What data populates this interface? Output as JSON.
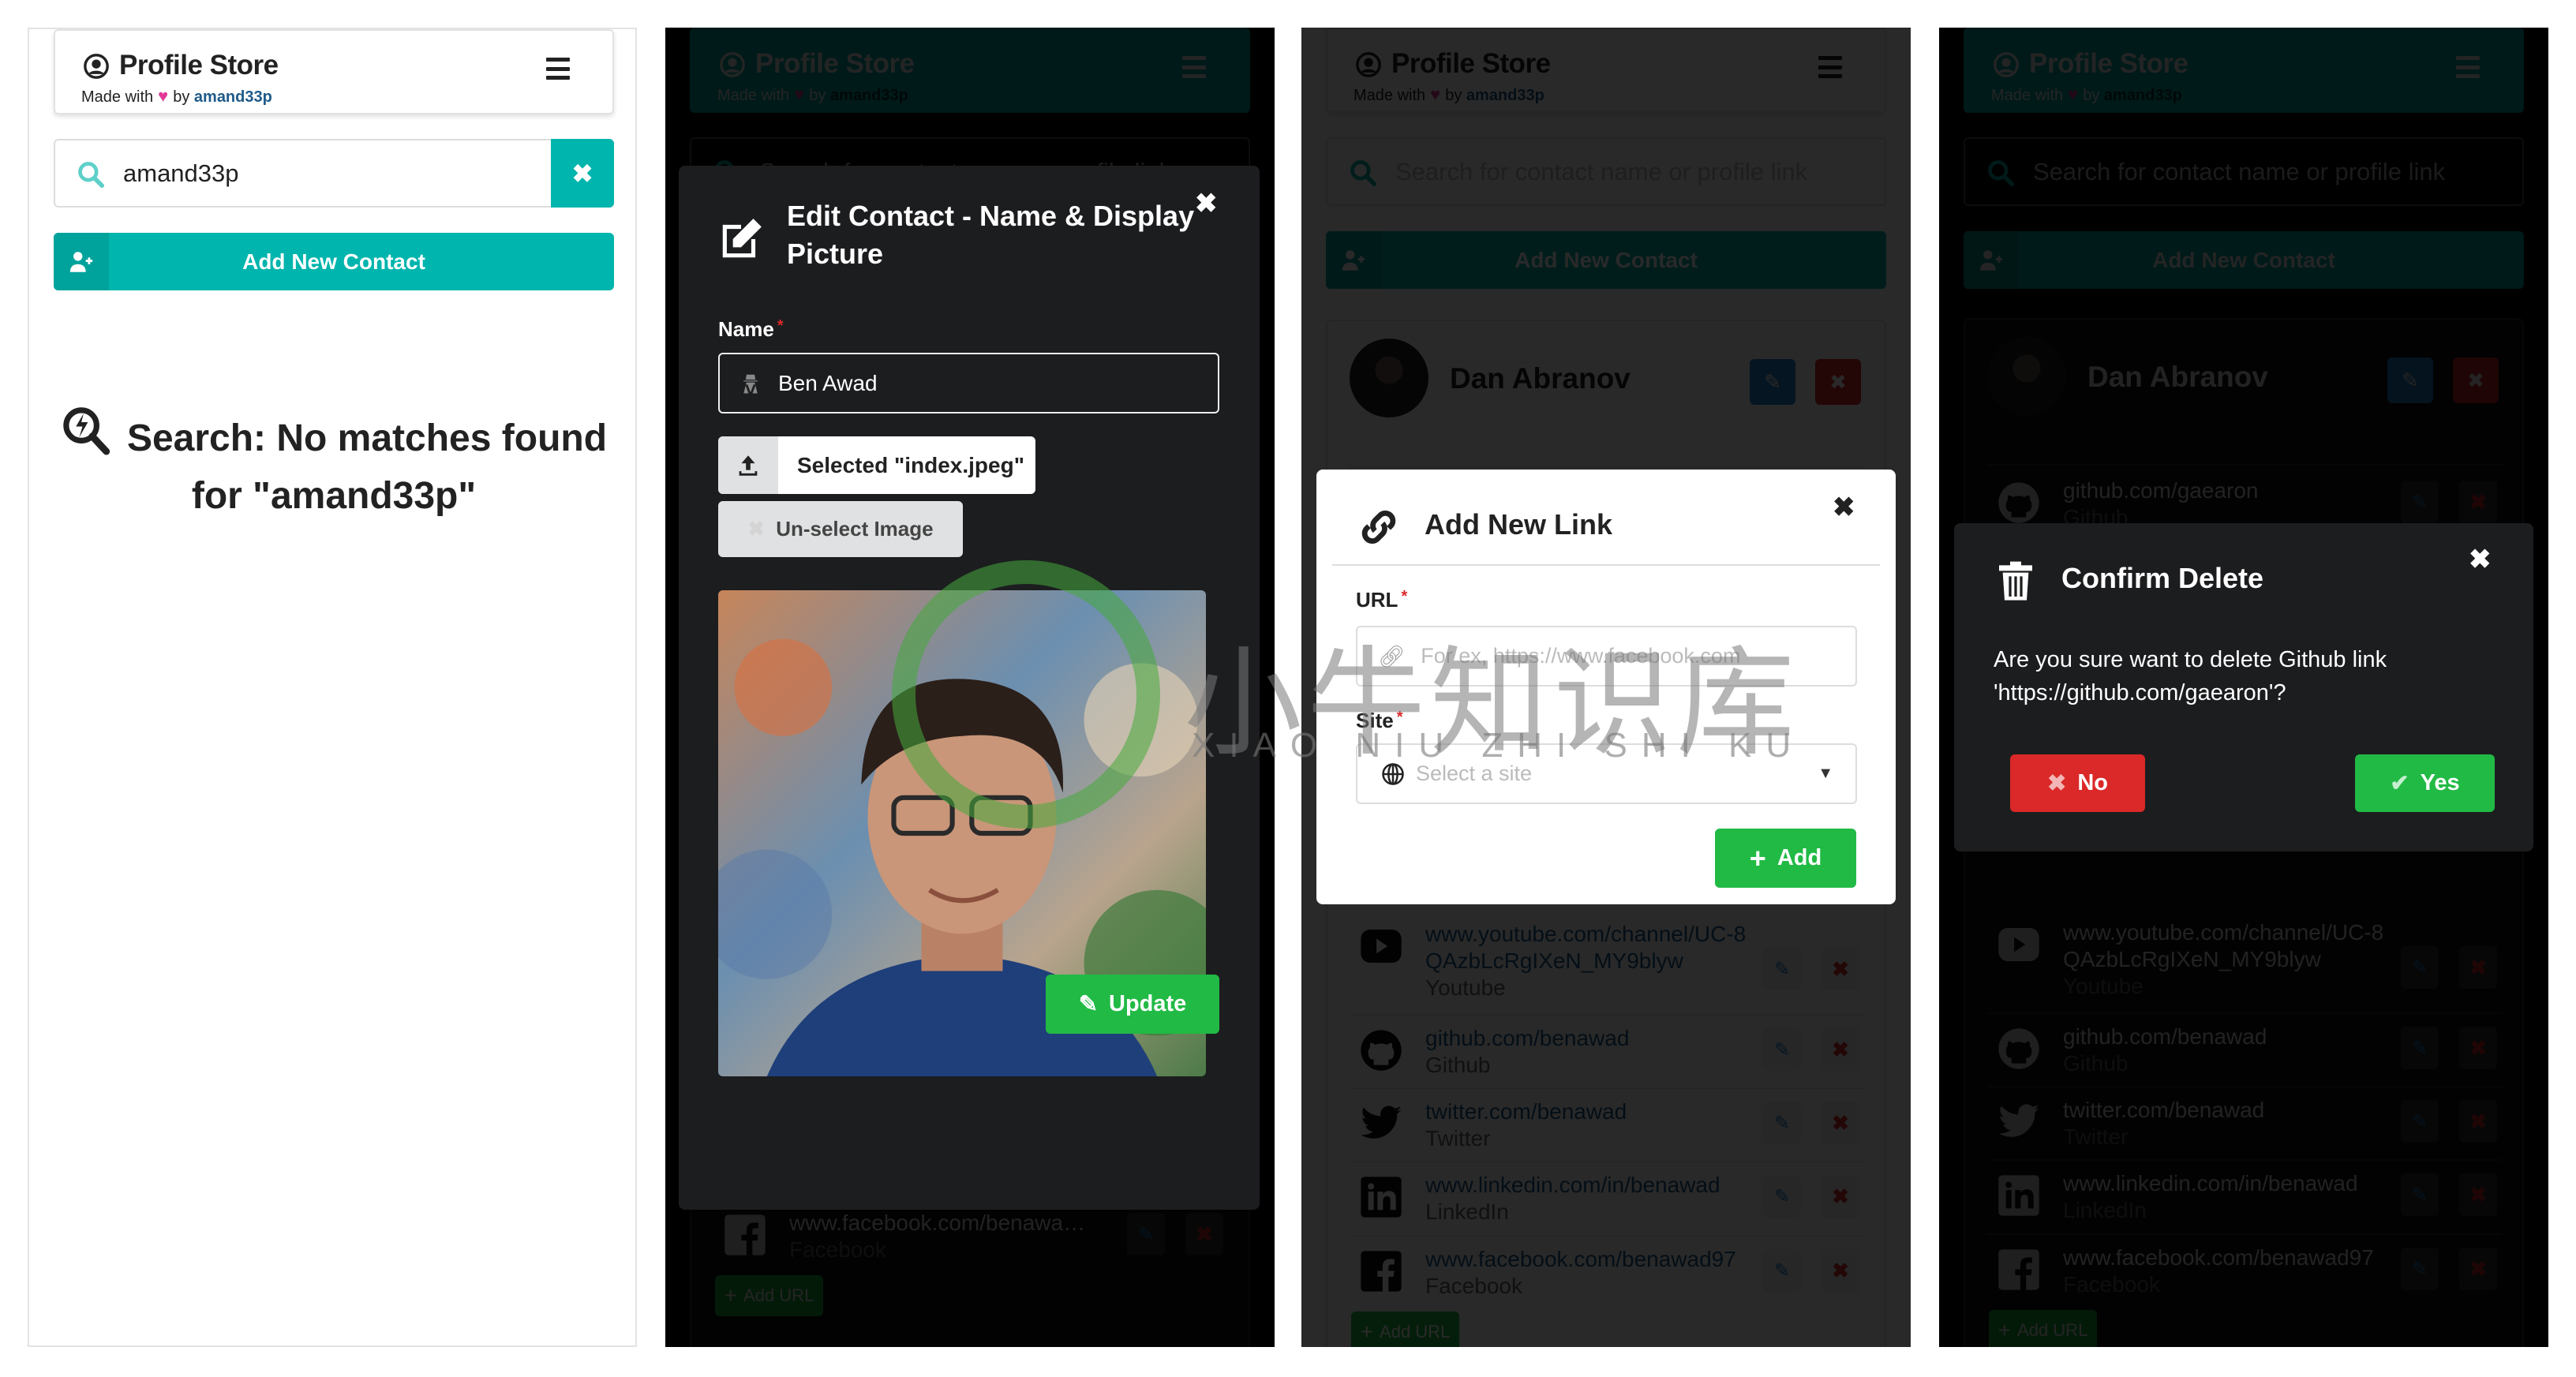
{
  "app": {
    "title": "Profile Store",
    "made_with": "Made with",
    "heart": "♥",
    "by": "by",
    "author": "amand33p",
    "search_placeholder": "Search for contact name or profile link",
    "add_contact_label": "Add New Contact",
    "add_url_label": "Add URL",
    "accent": "#00b5ad"
  },
  "panel1": {
    "search_value": "amand33p",
    "clear_icon": "close-icon",
    "no_match_line": "Search: No matches found for \"amand33p\""
  },
  "contact": {
    "name": "Dan Abranov",
    "links": [
      {
        "url": "github.com/gaearon",
        "site": "Github",
        "icon": "github"
      },
      {
        "url": "www.youtube.com/channel/UC-8QAzbLcRgIXeN_MY9blyw",
        "site": "Youtube",
        "icon": "youtube"
      },
      {
        "url": "github.com/benawad",
        "site": "Github",
        "icon": "github"
      },
      {
        "url": "twitter.com/benawad",
        "site": "Twitter",
        "icon": "twitter"
      },
      {
        "url": "www.linkedin.com/in/benawad",
        "site": "LinkedIn",
        "icon": "linkedin"
      },
      {
        "url": "www.facebook.com/benawad97",
        "site": "Facebook",
        "icon": "facebook"
      }
    ]
  },
  "edit_modal": {
    "title": "Edit Contact - Name & Display Picture",
    "name_label": "Name",
    "required": "*",
    "name_value": "Ben Awad",
    "selected_file": "Selected \"index.jpeg\"",
    "unselect_label": "Un-select Image",
    "update_label": "Update"
  },
  "link_modal": {
    "title": "Add New Link",
    "url_label": "URL",
    "url_placeholder": "For ex, https://www.facebook.com",
    "site_label": "Site",
    "site_placeholder": "Select a site",
    "add_label": "Add"
  },
  "delete_modal": {
    "title": "Confirm Delete",
    "message": "Are you sure want to delete Github link 'https://github.com/gaearon'?",
    "no_label": "No",
    "yes_label": "Yes"
  },
  "colors": {
    "green": "#21ba45",
    "red": "#db2828",
    "blue": "#2185d0",
    "modal_dark": "#1c1d1f"
  },
  "watermark": {
    "cn": "小牛知识库",
    "pinyin": "XIAO NIU ZHI SHI KU"
  }
}
